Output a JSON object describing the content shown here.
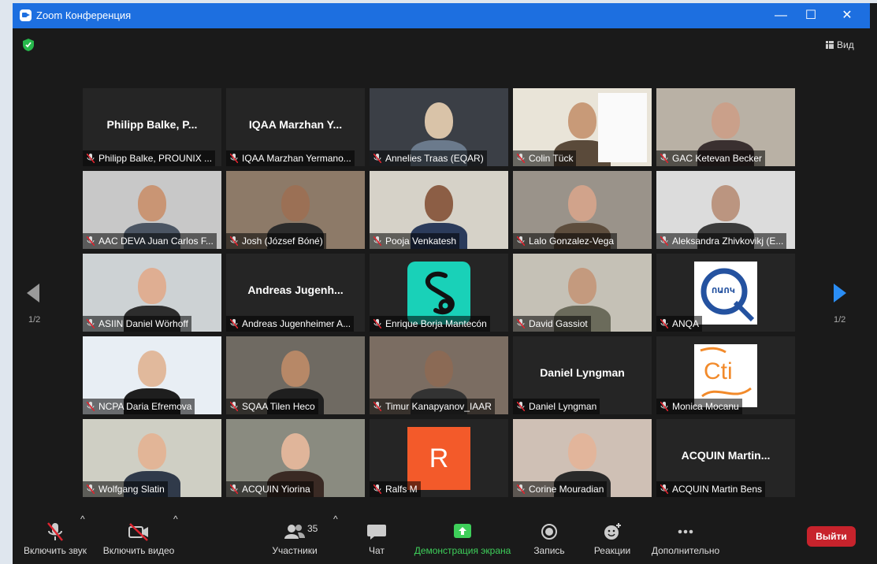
{
  "window": {
    "title": "Zoom Конференция",
    "controls": {
      "minimize": "—",
      "maximize": "☐",
      "close": "✕"
    }
  },
  "view_button": {
    "label": "Вид"
  },
  "pagination": {
    "prev_label": "1/2",
    "next_label": "1/2"
  },
  "tiles": [
    {
      "name": "Philipp Balke, PROUNIX ...",
      "big": "Philipp  Balke,  P...",
      "kind": "name"
    },
    {
      "name": "IQAA Marzhan Yermano...",
      "big": "IQAA  Marzhan  Y...",
      "kind": "name"
    },
    {
      "name": "Annelies Traas (EQAR)",
      "kind": "video"
    },
    {
      "name": "Colin Tück",
      "kind": "video"
    },
    {
      "name": "GAC Ketevan Becker",
      "kind": "video"
    },
    {
      "name": "AAC DEVA Juan Carlos F...",
      "kind": "video"
    },
    {
      "name": "Josh (József Bóné)",
      "kind": "video"
    },
    {
      "name": "Pooja Venkatesh",
      "kind": "video"
    },
    {
      "name": "Lalo Gonzalez-Vega",
      "kind": "video"
    },
    {
      "name": "Aleksandra Zhivkovikj (E...",
      "kind": "video"
    },
    {
      "name": "ASIIN Daniel Wörhoff",
      "kind": "video"
    },
    {
      "name": "Andreas Jugenheimer A...",
      "big": "Andreas  Jugenh...",
      "kind": "name"
    },
    {
      "name": "Enrique Borja Mantecón",
      "kind": "logo"
    },
    {
      "name": "David Gassiot",
      "kind": "video"
    },
    {
      "name": "ANQA",
      "kind": "logo",
      "logo_text": "ՈԱՈԿ"
    },
    {
      "name": "NCPA Daria Efremova",
      "kind": "video"
    },
    {
      "name": "SQAA Tilen Heco",
      "kind": "video"
    },
    {
      "name": "Timur Kanapyanov_IAAR",
      "kind": "video"
    },
    {
      "name": "Daniel Lyngman",
      "big": "Daniel Lyngman",
      "kind": "name"
    },
    {
      "name": "Monica Mocanu",
      "kind": "logo",
      "logo_text": "Cti"
    },
    {
      "name": "Wolfgang Slatin",
      "kind": "video"
    },
    {
      "name": "ACQUIN Yiorina",
      "kind": "video"
    },
    {
      "name": "Ralfs M",
      "kind": "avatar",
      "letter": "R"
    },
    {
      "name": "Corine Mouradian",
      "kind": "video",
      "active": true
    },
    {
      "name": "ACQUIN Martin Bens",
      "big": "ACQUIN  Martin...",
      "kind": "name"
    }
  ],
  "toolbar": {
    "audio": "Включить звук",
    "video": "Включить видео",
    "participants": "Участники",
    "participants_count": "35",
    "chat": "Чат",
    "share": "Демонстрация экрана",
    "record": "Запись",
    "reactions": "Реакции",
    "more": "Дополнительно",
    "leave": "Выйти"
  },
  "colors": {
    "title_bar": "#1d6fe0",
    "active_speaker": "#c8e06b",
    "share_green": "#3ecf5a",
    "leave_red": "#c7232c",
    "muted_red": "#e0242f"
  }
}
